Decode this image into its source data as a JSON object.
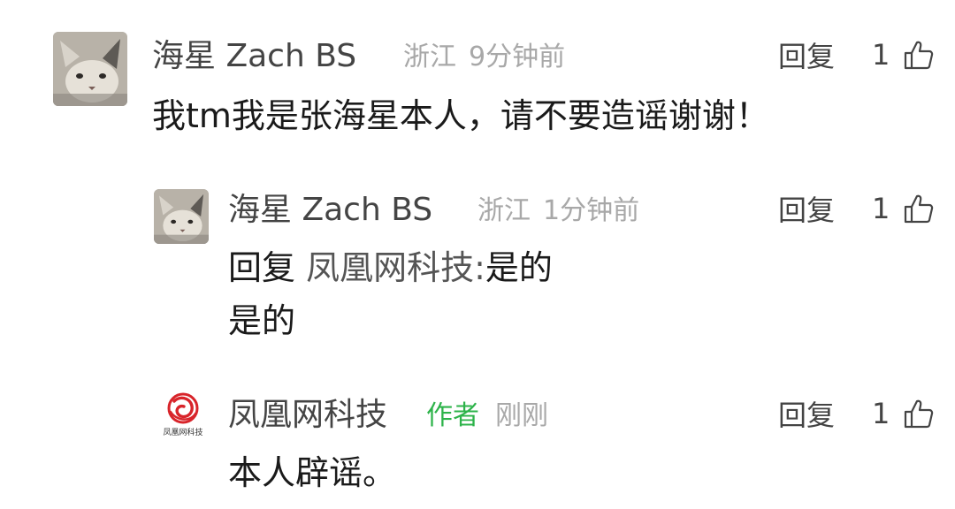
{
  "comments": [
    {
      "username": "海星 Zach BS",
      "region": "浙江",
      "time": "9分钟前",
      "reply_label": "回复",
      "likes": "1",
      "text": "我tm我是张海星本人，请不要造谣谢谢！",
      "avatar_icon": "cat-avatar"
    },
    {
      "username": "海星 Zach BS",
      "region": "浙江",
      "time": "1分钟前",
      "reply_label": "回复",
      "likes": "1",
      "reply_prefix": "回复",
      "reply_target": "凤凰网科技:",
      "reply_quote": "是的",
      "text": "是的",
      "avatar_icon": "cat-avatar"
    },
    {
      "username": "凤凰网科技",
      "author_badge": "作者",
      "time": "刚刚",
      "reply_label": "回复",
      "likes": "1",
      "text": "本人辟谣。",
      "avatar_icon": "ifeng-tech-logo",
      "avatar_caption": "凤凰网科技"
    }
  ],
  "colors": {
    "author_badge": "#2db34a",
    "meta": "#a8a8a8",
    "logo_red": "#d8242a"
  }
}
